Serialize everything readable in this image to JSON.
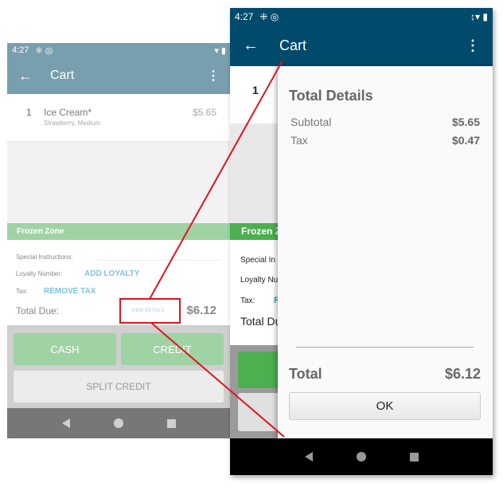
{
  "status": {
    "time": "4:27"
  },
  "appbar": {
    "title": "Cart"
  },
  "cart": {
    "item": {
      "qty": "1",
      "name": "Ice Cream*",
      "options": "Strawberry, Medium",
      "price": "$5.65"
    }
  },
  "zone": "Frozen Zone",
  "details": {
    "special_label": "Special Instructions:",
    "loyalty_label": "Loyalty Number:",
    "loyalty_action": "ADD LOYALTY",
    "tax_label": "Tax:",
    "tax_action": "REMOVE TAX",
    "total_label": "Total Due:",
    "view_details": "VIEW DETAILS",
    "total": "$6.12"
  },
  "buttons": {
    "cash": "CASH",
    "credit": "CREDIT",
    "split": "SPLIT CREDIT"
  },
  "partial": {
    "qty": "1",
    "zone": "Frozen Z",
    "special": "Special In",
    "loyalty": "Loyalty Nu",
    "tax": "Tax:",
    "tax_action": "R",
    "total": "Total Du"
  },
  "dialog": {
    "title": "Total Details",
    "subtotal_label": "Subtotal",
    "subtotal": "$5.65",
    "tax_label": "Tax",
    "tax": "$0.47",
    "total_label": "Total",
    "total": "$6.12",
    "ok": "OK"
  },
  "colors": {
    "appbar_left": "#789fae",
    "appbar_right": "#004a6b",
    "green_light": "#9fd3a4",
    "green": "#4caf50",
    "link": "#4aa8d0",
    "callout": "#e0141e"
  }
}
